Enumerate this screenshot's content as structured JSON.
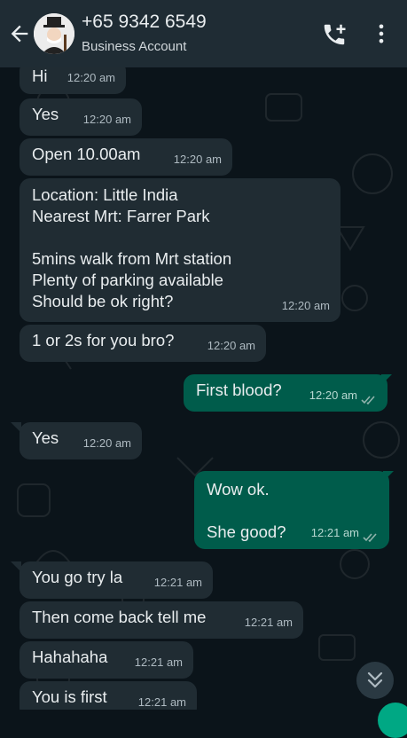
{
  "header": {
    "contact_name": "+65 9342 6549",
    "subtitle": "Business Account",
    "back_icon": "arrow-left-icon",
    "call_icon": "add-call-icon",
    "menu_icon": "more-vertical-icon"
  },
  "colors": {
    "header_bg": "#1f2c34",
    "chat_bg": "#0b141a",
    "incoming_bubble": "#202c33",
    "outgoing_bubble": "#005c4b",
    "read_ticks": "#8fb3ac"
  },
  "messages": [
    {
      "direction": "in",
      "text": "Hi",
      "time": "12:20 am"
    },
    {
      "direction": "in",
      "text": "Yes",
      "time": "12:20 am"
    },
    {
      "direction": "in",
      "text": "Open 10.00am",
      "time": "12:20 am"
    },
    {
      "direction": "in",
      "text": "Location: Little India\nNearest Mrt: Farrer Park\n\n5mins walk from Mrt station\nPlenty of parking available\nShould be ok right?",
      "time": "12:20 am"
    },
    {
      "direction": "in",
      "text": "1 or 2s for you bro?",
      "time": "12:20 am"
    },
    {
      "direction": "out",
      "text": "First blood?",
      "time": "12:20 am",
      "status": "read"
    },
    {
      "direction": "in",
      "text": "Yes",
      "time": "12:20 am"
    },
    {
      "direction": "out",
      "text": "Wow ok.\n\nShe good?",
      "time": "12:21 am",
      "status": "read"
    },
    {
      "direction": "in",
      "text": "You go try la",
      "time": "12:21 am"
    },
    {
      "direction": "in",
      "text": "Then come back tell me",
      "time": "12:21 am"
    },
    {
      "direction": "in",
      "text": "Hahahaha",
      "time": "12:21 am"
    },
    {
      "direction": "in",
      "text": "You is first",
      "time": "12:21 am"
    }
  ],
  "scroll_button_icon": "double-chevron-down-icon"
}
